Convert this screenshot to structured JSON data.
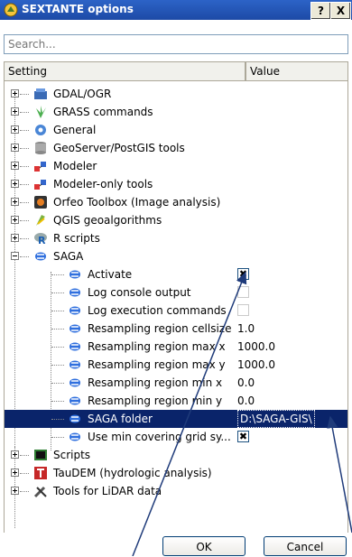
{
  "window": {
    "title": "SEXTANTE options",
    "help_label": "?",
    "close_label": "X"
  },
  "search": {
    "placeholder": "Search..."
  },
  "columns": {
    "setting": "Setting",
    "value": "Value"
  },
  "tree": {
    "groups": [
      {
        "label": "GDAL/OGR",
        "icon": "gdal-icon"
      },
      {
        "label": "GRASS commands",
        "icon": "grass-icon"
      },
      {
        "label": "General",
        "icon": "gear-icon"
      },
      {
        "label": "GeoServer/PostGIS tools",
        "icon": "database-icon"
      },
      {
        "label": "Modeler",
        "icon": "modeler-icon"
      },
      {
        "label": "Modeler-only tools",
        "icon": "modeler-icon"
      },
      {
        "label": "Orfeo Toolbox (Image analysis)",
        "icon": "orfeo-icon"
      },
      {
        "label": "QGIS geoalgorithms",
        "icon": "qgis-icon"
      },
      {
        "label": "R scripts",
        "icon": "r-icon"
      },
      {
        "label": "SAGA",
        "icon": "saga-icon"
      },
      {
        "label": "Scripts",
        "icon": "scripts-icon"
      },
      {
        "label": "TauDEM (hydrologic analysis)",
        "icon": "taudem-icon"
      },
      {
        "label": "Tools for LiDAR data",
        "icon": "lidar-icon"
      }
    ],
    "saga_settings": [
      {
        "label": "Activate",
        "value": "✖"
      },
      {
        "label": "Log console output",
        "value": ""
      },
      {
        "label": "Log execution commands",
        "value": ""
      },
      {
        "label": "Resampling region cellsize",
        "value": "1.0"
      },
      {
        "label": "Resampling region max x",
        "value": "1000.0"
      },
      {
        "label": "Resampling region max y",
        "value": "1000.0"
      },
      {
        "label": "Resampling region min x",
        "value": "0.0"
      },
      {
        "label": "Resampling region min y",
        "value": "0.0"
      },
      {
        "label": "SAGA folder",
        "value": "D:\\SAGA-GIS\\"
      },
      {
        "label": "Use min covering grid sy...",
        "value": "✖"
      }
    ]
  },
  "buttons": {
    "ok": "OK",
    "cancel": "Cancel"
  },
  "colors": {
    "titlebar": "#1d4aa6",
    "selection": "#0a246a",
    "annotation": "#1f3b7a"
  }
}
